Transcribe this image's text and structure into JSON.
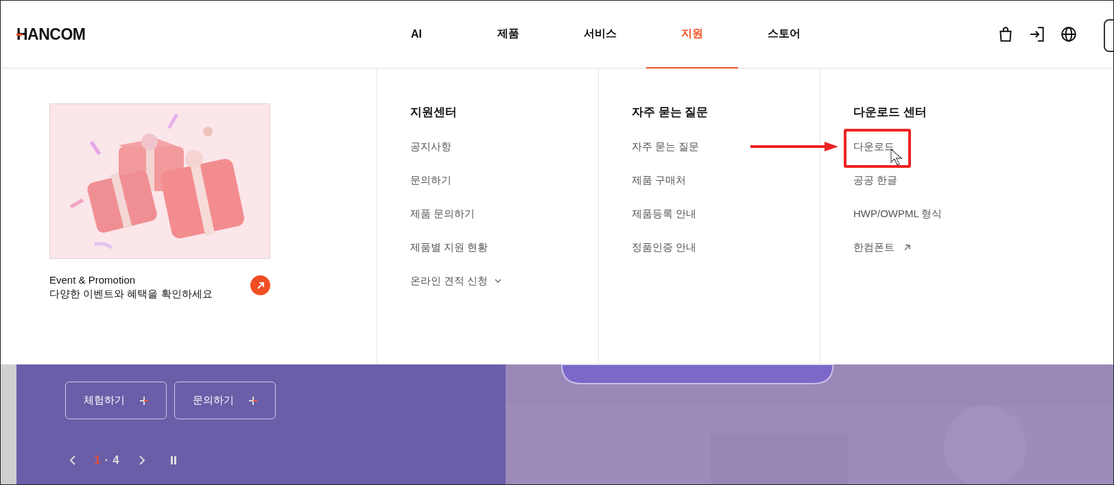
{
  "header": {
    "logo": "HANCOM",
    "nav": [
      {
        "label": "AI",
        "selected": false
      },
      {
        "label": "제품",
        "selected": false
      },
      {
        "label": "서비스",
        "selected": false
      },
      {
        "label": "지원",
        "selected": true
      },
      {
        "label": "스토어",
        "selected": false
      }
    ]
  },
  "promo": {
    "kind": "picture",
    "title": "Event & Promotion",
    "subtitle": "다양한 이벤트와 혜택을 확인하세요"
  },
  "menu_columns": [
    {
      "heading": "지원센터",
      "items": [
        {
          "label": "공지사항",
          "kind": "link",
          "highlighted": false
        },
        {
          "label": "문의하기",
          "kind": "link",
          "highlighted": false
        },
        {
          "label": "제품 문의하기",
          "kind": "link",
          "highlighted": false
        },
        {
          "label": "제품별 지원 현황",
          "kind": "link",
          "highlighted": false
        },
        {
          "label": "온라인 견적 신청",
          "kind": "dropdown",
          "highlighted": false
        }
      ]
    },
    {
      "heading": "자주 묻는 질문",
      "items": [
        {
          "label": "자주 묻는 질문",
          "kind": "link",
          "highlighted": false
        },
        {
          "label": "제품 구매처",
          "kind": "link",
          "highlighted": false
        },
        {
          "label": "제품등록 안내",
          "kind": "link",
          "highlighted": false
        },
        {
          "label": "정품인증 안내",
          "kind": "link",
          "highlighted": false
        }
      ]
    },
    {
      "heading": "다운로드 센터",
      "items": [
        {
          "label": "다운로드",
          "kind": "link",
          "highlighted": true
        },
        {
          "label": "공공 한글",
          "kind": "link",
          "highlighted": false
        },
        {
          "label": "HWP/OWPML 형식",
          "kind": "link",
          "highlighted": false
        },
        {
          "label": "한컴폰트",
          "kind": "external",
          "highlighted": false
        }
      ]
    }
  ],
  "hero": {
    "buttons": [
      {
        "label": "체험하기"
      },
      {
        "label": "문의하기"
      }
    ],
    "pager": {
      "current": "1",
      "separator": "·",
      "total": "4"
    }
  }
}
